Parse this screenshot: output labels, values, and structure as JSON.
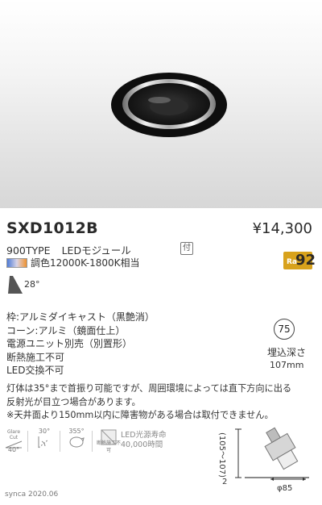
{
  "product": {
    "model": "SXD1012B",
    "price": "¥14,300",
    "type": "900TYPE",
    "module": "LEDモジュール",
    "attached_badge": "付",
    "ra_label": "Ra",
    "ra_value": "92",
    "toning": "調色12000K-1800K相当",
    "beam_angle": "28°"
  },
  "specs": [
    "枠:アルミダイキャスト（黒艶消）",
    "コーン:アルミ（鏡面仕上）",
    "電源ユニット別売（別置形）",
    "断熱施工不可",
    "LED交換不可"
  ],
  "embed": {
    "hole": "75",
    "depth_label": "埋込深さ",
    "depth_value": "107mm"
  },
  "notes": [
    "灯体は35°まで首振り可能ですが、周囲環境によっては直下方向に出る",
    "反射光が目立つ場合があります。",
    "※天井面より150mm以内に障害物がある場合は取付できません。"
  ],
  "icons": {
    "glare_label": "Glare Cut",
    "glare_value": "40°",
    "tilt_value": "30°",
    "rotate_value": "355°",
    "no_insulation": "断熱施工不可",
    "life_line1": "LED光源寿命",
    "life_line2": "40,000時間"
  },
  "dimensions": {
    "height": "(105～107)",
    "bottom": "2",
    "diameter": "φ85"
  },
  "footer": "synca 2020.06"
}
